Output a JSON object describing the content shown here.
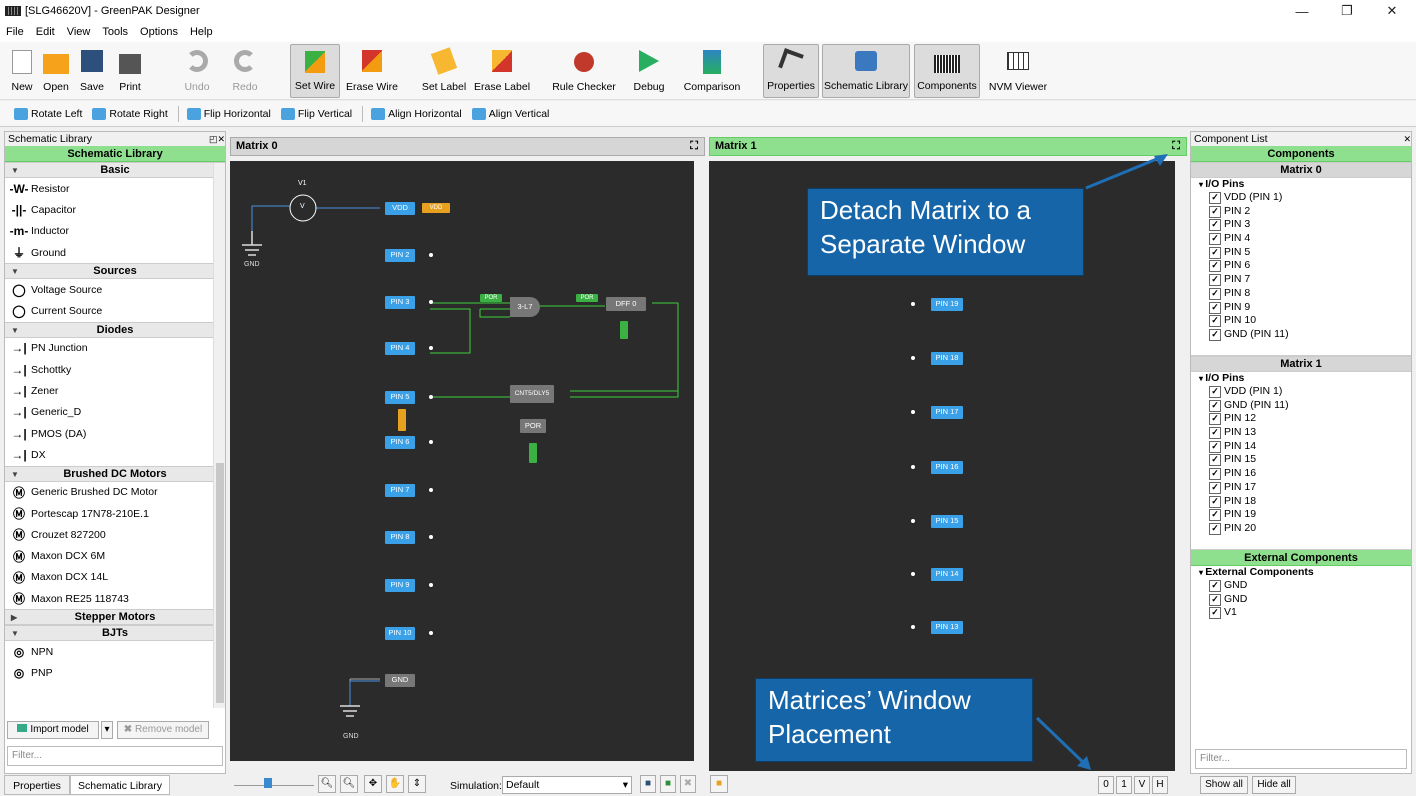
{
  "window": {
    "title": "[SLG46620V] - GreenPAK Designer",
    "min": "—",
    "max": "❐",
    "close": "✕"
  },
  "menu": [
    "File",
    "Edit",
    "View",
    "Tools",
    "Options",
    "Help"
  ],
  "toolbar": [
    {
      "label": "New",
      "icon": "new-file-icon",
      "active": false,
      "disabled": false
    },
    {
      "label": "Open",
      "icon": "open-folder-icon",
      "active": false,
      "disabled": false
    },
    {
      "label": "Save",
      "icon": "save-icon",
      "active": false,
      "disabled": false
    },
    {
      "label": "Print",
      "icon": "printer-icon",
      "active": false,
      "disabled": false
    },
    {
      "label": "Undo",
      "icon": "undo-icon",
      "active": false,
      "disabled": true
    },
    {
      "label": "Redo",
      "icon": "redo-icon",
      "active": false,
      "disabled": true
    },
    {
      "label": "Set Wire",
      "icon": "set-wire-icon",
      "active": true,
      "disabled": false
    },
    {
      "label": "Erase Wire",
      "icon": "erase-wire-icon",
      "active": false,
      "disabled": false
    },
    {
      "label": "Set Label",
      "icon": "set-label-icon",
      "active": false,
      "disabled": false
    },
    {
      "label": "Erase Label",
      "icon": "erase-label-icon",
      "active": false,
      "disabled": false
    },
    {
      "label": "Rule Checker",
      "icon": "ladybug-icon",
      "active": false,
      "disabled": false
    },
    {
      "label": "Debug",
      "icon": "debug-icon",
      "active": false,
      "disabled": false
    },
    {
      "label": "Comparison",
      "icon": "comparison-icon",
      "active": false,
      "disabled": false
    },
    {
      "label": "Properties",
      "icon": "properties-icon",
      "active": true,
      "disabled": false
    },
    {
      "label": "Schematic Library",
      "icon": "schematic-library-icon",
      "active": true,
      "disabled": false
    },
    {
      "label": "Components",
      "icon": "chip-icon",
      "active": true,
      "disabled": false
    },
    {
      "label": "NVM Viewer",
      "icon": "nvm-grid-icon",
      "active": false,
      "disabled": false
    }
  ],
  "toolbar2": [
    "Rotate Left",
    "Rotate Right",
    "Flip Horizontal",
    "Flip Vertical",
    "Align Horizontal",
    "Align Vertical"
  ],
  "library": {
    "panel_title": "Schematic Library",
    "header": "Schematic Library",
    "categories": [
      {
        "name": "Basic",
        "items": [
          "Resistor",
          "Capacitor",
          "Inductor",
          "Ground"
        ]
      },
      {
        "name": "Sources",
        "items": [
          "Voltage Source",
          "Current Source"
        ]
      },
      {
        "name": "Diodes",
        "items": [
          "PN Junction",
          "Schottky",
          "Zener",
          "Generic_D",
          "PMOS (DA)",
          "DX"
        ]
      },
      {
        "name": "Brushed DC Motors",
        "items": [
          "Generic Brushed DC Motor",
          "Portescap 17N78-210E.1",
          "Crouzet 827200",
          "Maxon DCX 6M",
          "Maxon DCX 14L",
          "Maxon RE25 118743"
        ]
      },
      {
        "name": "Stepper Motors",
        "items": []
      },
      {
        "name": "BJTs",
        "items": [
          "NPN",
          "PNP"
        ]
      }
    ],
    "import_label": "Import model",
    "remove_label": "Remove model",
    "filter_placeholder": "Filter..."
  },
  "matrix0": {
    "title": "Matrix 0",
    "labels": {
      "v1": "V1",
      "v": "V",
      "gnd": "GND",
      "vdd": "VDD",
      "vdd_tag": "VDD",
      "lut": "3-L7",
      "dff": "DFF 0",
      "cnt": "CNT5/DLY5",
      "por": "POR",
      "por_tag": "POR",
      "gnd_pin": "GND",
      "gnd2": "GND",
      "pdir": "POR"
    },
    "pins": [
      "PIN 2",
      "PIN 3",
      "PIN 4",
      "PIN 5",
      "PIN 6",
      "PIN 7",
      "PIN 8",
      "PIN 9",
      "PIN 10"
    ]
  },
  "matrix1": {
    "title": "Matrix 1",
    "pins": [
      "PIN 19",
      "PIN 18",
      "PIN 17",
      "PIN 16",
      "PIN 15",
      "PIN 14",
      "PIN 13"
    ]
  },
  "callouts": {
    "detach": "Detach Matrix to a Separate Window",
    "placement": "Matrices’ Window Placement"
  },
  "bottom": {
    "tabs": [
      "Properties",
      "Schematic Library"
    ],
    "simulation_label": "Simulation:",
    "simulation_value": "Default",
    "placement_buttons": [
      "0",
      "1",
      "V",
      "H"
    ]
  },
  "components": {
    "panel_title": "Component List",
    "header": "Components",
    "matrix0": {
      "title": "Matrix 0",
      "group": "I/O Pins",
      "items": [
        "VDD (PIN 1)",
        "PIN 2",
        "PIN 3",
        "PIN 4",
        "PIN 5",
        "PIN 6",
        "PIN 7",
        "PIN 8",
        "PIN 9",
        "PIN 10",
        "GND (PIN 11)"
      ]
    },
    "matrix1": {
      "title": "Matrix 1",
      "group": "I/O Pins",
      "items": [
        "VDD (PIN 1)",
        "GND (PIN 11)",
        "PIN 12",
        "PIN 13",
        "PIN 14",
        "PIN 15",
        "PIN 16",
        "PIN 17",
        "PIN 18",
        "PIN 19",
        "PIN 20"
      ]
    },
    "external": {
      "title": "External Components",
      "group": "External Components",
      "items": [
        "GND",
        "GND",
        "V1"
      ]
    },
    "filter_placeholder": "Filter...",
    "show_all": "Show all",
    "hide_all": "Hide all"
  },
  "colors": {
    "accent_green": "#8ee08e",
    "pin_blue": "#3aa0e8",
    "callout_blue": "#1565a8",
    "canvas": "#2b2b2b"
  }
}
